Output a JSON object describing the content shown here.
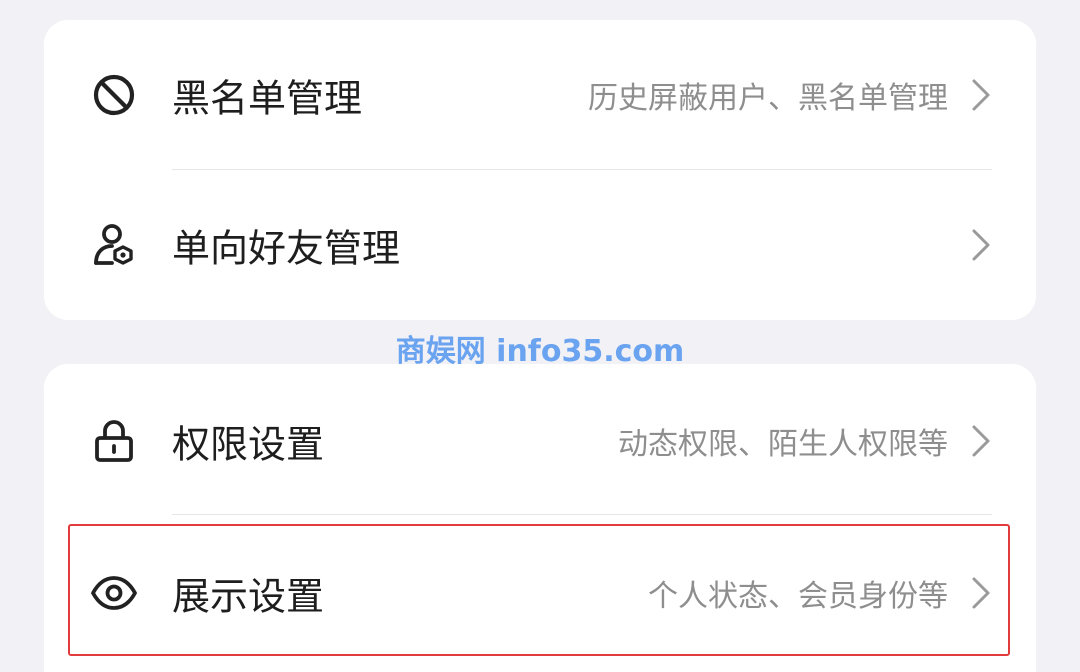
{
  "sections": [
    {
      "rows": [
        {
          "icon": "block-icon",
          "title": "黑名单管理",
          "subtitle": "历史屏蔽用户、黑名单管理"
        },
        {
          "icon": "user-shield-icon",
          "title": "单向好友管理",
          "subtitle": ""
        }
      ]
    },
    {
      "rows": [
        {
          "icon": "lock-icon",
          "title": "权限设置",
          "subtitle": "动态权限、陌生人权限等"
        },
        {
          "icon": "eye-icon",
          "title": "展示设置",
          "subtitle": "个人状态、会员身份等"
        }
      ]
    }
  ],
  "watermark": "商娱网 info35.com",
  "highlight_color": "#e23b3b",
  "accent_watermark_color": "#6aa3f0"
}
